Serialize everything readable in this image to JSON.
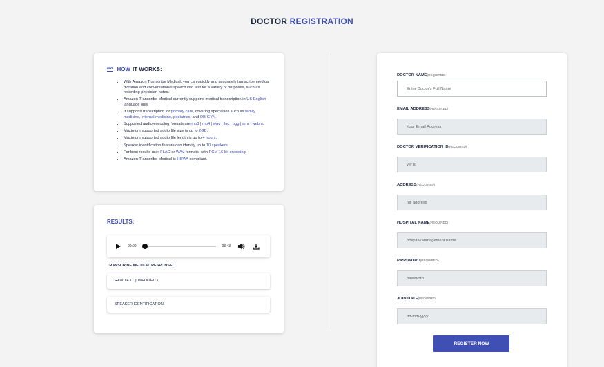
{
  "header": {
    "title_part1": "DOCTOR",
    "title_part2": "REGISTRATION"
  },
  "how_it_works": {
    "icon": "aws-icon",
    "title_part1": "HOW",
    "title_part2": "IT WORKS:",
    "bullets": [
      {
        "pre": "With Amazon Transcribe Medical, you can quickly and accurately transcribe medical dictation and conversational speech into text for a variety of purposes, such as recording physician notes."
      },
      {
        "pre": "Amazon Transcribe Medical currently supports medical transcription in ",
        "hl": "US English",
        "post": " language only."
      },
      {
        "pre": "It supports transcription for ",
        "hl": "primary care",
        "mid": ", covering specialties such as ",
        "hl2": "family medicine, internal medicine, pediatrics,",
        "mid2": " and ",
        "hl3": "OB-GYN",
        "post": "."
      },
      {
        "pre": "Supported audio encoding formats are ",
        "hl": "mp3 | mp4 | wav | flac | ogg | amr | webm",
        "post": "."
      },
      {
        "pre": "Maximum supported audio file size is up to ",
        "hl": "2GB",
        "post": "."
      },
      {
        "pre": "Maximum supported audio file length is up to ",
        "hl": "4 hours",
        "post": "."
      },
      {
        "pre": "Speaker identification feature can identify up to ",
        "hl": "10 speakers",
        "post": "."
      },
      {
        "pre": "For best results use: ",
        "hl": "FLAC",
        "mid": " or ",
        "hl2": "WAV",
        "mid2": " formats, with ",
        "hl3": "PCM 16-bit encoding",
        "post": "."
      },
      {
        "pre": "Amazon Transcribe Medical is ",
        "hl": "HIPAA",
        "post": " compliant."
      }
    ]
  },
  "results": {
    "title": "RESULTS:",
    "player": {
      "current_time": "00:00",
      "duration": "03:43",
      "progress": 0
    },
    "response_label": "TRANSCRIBE MEDICAL RESPONSE:",
    "sections": [
      "RAW TEXT (UNEDITED )",
      "SPEAKER IDENTIFICATION"
    ]
  },
  "form": {
    "fields": [
      {
        "label": "DOCTOR NAME",
        "req": "(REQUIRED)",
        "placeholder": "Enter Doctor's Full Name"
      },
      {
        "label": "EMAIL ADDRESS",
        "req": "(REQUIRED)",
        "placeholder": "Your Email Address"
      },
      {
        "label": "DOCTOR VERIFICATION ID",
        "req": "(REQUIRED)",
        "placeholder": "ver id"
      },
      {
        "label": "ADDRESS",
        "req": "(REQUIRED)",
        "placeholder": "full address"
      },
      {
        "label": "HOSPITAL NAME",
        "req": "(REQUIRED)",
        "placeholder": "hospital/Management name"
      },
      {
        "label": "PASSWORD",
        "req": "(REQUIRED)",
        "placeholder": "password"
      },
      {
        "label": "JOIN DATE",
        "req": "(REQUIRED)",
        "placeholder": "dd-mm-yyyy"
      }
    ],
    "submit_label": "REGISTER NOW"
  },
  "colors": {
    "accent": "#3f4fb3",
    "dark": "#1e2740",
    "background": "#f3f3f3"
  }
}
